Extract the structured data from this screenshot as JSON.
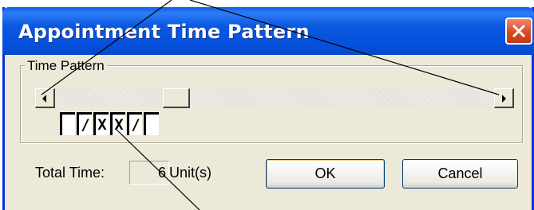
{
  "window": {
    "title": "Appointment Time Pattern"
  },
  "group": {
    "label": "Time Pattern"
  },
  "pattern": {
    "cells": [
      "",
      "/",
      "X",
      "X",
      "/",
      ""
    ]
  },
  "total": {
    "label": "Total Time:",
    "value": "6",
    "unit_label": "Unit(s)"
  },
  "buttons": {
    "ok_label": "OK",
    "cancel_label": "Cancel"
  },
  "colors": {
    "titlebar": "#0550dc",
    "close": "#d94a25",
    "dialog_bg": "#ece9d8"
  }
}
